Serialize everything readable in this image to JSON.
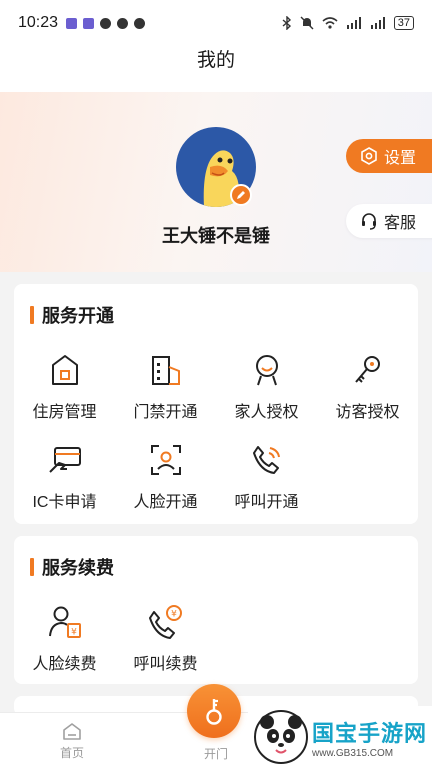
{
  "status_bar": {
    "time": "10:23",
    "battery": "37"
  },
  "header": {
    "title": "我的"
  },
  "profile": {
    "username": "王大锤不是锤",
    "settings_label": "设置",
    "service_label": "客服"
  },
  "service_open": {
    "title": "服务开通",
    "items": [
      {
        "label": "住房管理",
        "icon": "house-icon"
      },
      {
        "label": "门禁开通",
        "icon": "building-icon"
      },
      {
        "label": "家人授权",
        "icon": "person-icon"
      },
      {
        "label": "访客授权",
        "icon": "key-icon"
      },
      {
        "label": "IC卡申请",
        "icon": "card-icon"
      },
      {
        "label": "人脸开通",
        "icon": "face-scan-icon"
      },
      {
        "label": "呼叫开通",
        "icon": "phone-call-icon"
      }
    ]
  },
  "service_renew": {
    "title": "服务续费",
    "items": [
      {
        "label": "人脸续费",
        "icon": "person-yuan-icon"
      },
      {
        "label": "呼叫续费",
        "icon": "phone-yuan-icon"
      }
    ]
  },
  "bottom_nav": {
    "home_label": "首页",
    "open_label": "开门"
  },
  "watermark": {
    "title": "国宝手游网",
    "url": "www.GB315.COM"
  },
  "colors": {
    "accent": "#f07a22"
  }
}
